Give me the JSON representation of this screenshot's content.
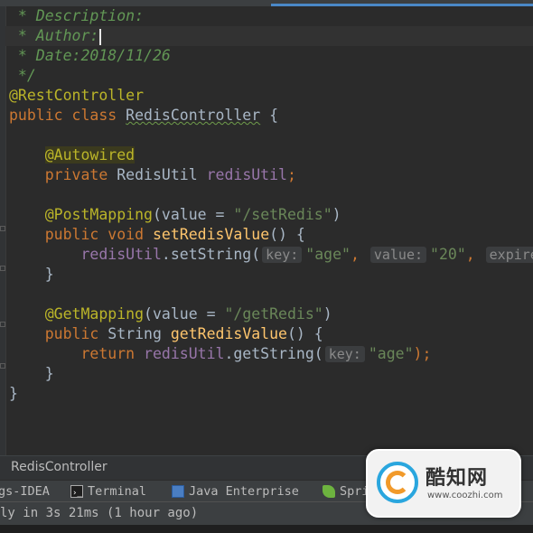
{
  "code": {
    "comment_description": " * Description:",
    "comment_author": " * Author:",
    "comment_date": " * Date:2018/11/26",
    "comment_end": " */",
    "annotation_rest": "@RestController",
    "kw_public": "public",
    "kw_class": "class",
    "class_name": "RedisController",
    "brace_open": " {",
    "annotation_autowired": "@Autowired",
    "kw_private": "private",
    "type_redisutil": "RedisUtil",
    "field_redisutil": "redisUtil",
    "semicolon": ";",
    "annotation_postmapping": "@PostMapping",
    "paren_open": "(",
    "attr_value": "value",
    "equals": " = ",
    "string_setredis": "\"/setRedis\"",
    "paren_close": ")",
    "kw_void": "void",
    "method_set": "setRedisValue",
    "empty_parens_brace": "() {",
    "call_setstring": ".setString(",
    "hint_key": "key:",
    "string_age": "\"age\"",
    "comma": ",",
    "hint_value": "value:",
    "string_20": "\"20\"",
    "hint_expire": "expire",
    "brace_close": "}",
    "annotation_getmapping": "@GetMapping",
    "string_getredis": "\"/getRedis\"",
    "type_string": "String",
    "method_get": "getRedisValue",
    "kw_return": "return",
    "call_getstring": ".getString(",
    "close_semicolon": ");"
  },
  "breadcrumb": {
    "item": "RedisController"
  },
  "tool_windows": {
    "ide_label": "gs-IDEA",
    "terminal": "Terminal",
    "java_enterprise": "Java Enterprise",
    "spring": "Spri"
  },
  "status": {
    "message": "ly in 3s 21ms (1 hour ago)"
  },
  "watermark": {
    "title": "酷知网",
    "url": "www.coozhi.com"
  },
  "icons": {
    "terminal": "terminal-icon",
    "java_enterprise": "java-enterprise-icon",
    "spring": "spring-leaf-icon",
    "watermark_logo": "coozhi-logo-icon"
  },
  "colors": {
    "background": "#2b2b2b",
    "keyword": "#cc7832",
    "annotation": "#bbb529",
    "method": "#ffc66d",
    "field": "#9876aa",
    "string": "#6a8759",
    "comment": "#629755",
    "text": "#a9b7c6"
  }
}
